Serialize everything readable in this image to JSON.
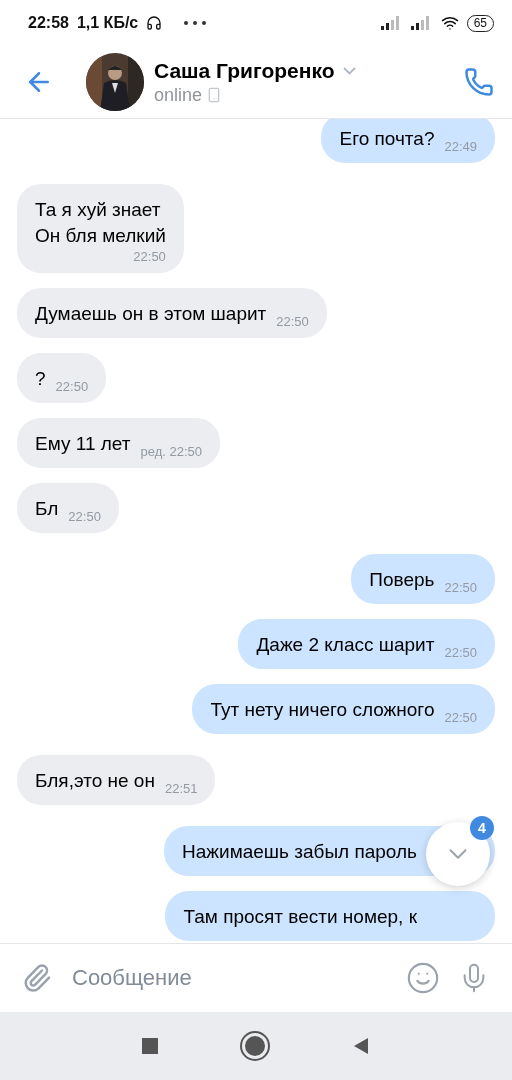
{
  "status_bar": {
    "time": "22:58",
    "speed": "1,1 КБ/с",
    "battery": "65"
  },
  "header": {
    "name": "Саша Григоренко",
    "status": "online"
  },
  "messages": [
    {
      "kind": "outgoing",
      "lines": [
        "Его почта?"
      ],
      "time": "22:49"
    },
    {
      "kind": "incoming",
      "lines": [
        "Та я хуй знает",
        "Он бля мелкий"
      ],
      "time": "22:50"
    },
    {
      "kind": "incoming",
      "lines": [
        "Думаешь он в этом шарит"
      ],
      "time": "22:50"
    },
    {
      "kind": "incoming",
      "lines": [
        "?"
      ],
      "time": "22:50"
    },
    {
      "kind": "incoming",
      "lines": [
        "Ему 11 лет"
      ],
      "time": "ред. 22:50"
    },
    {
      "kind": "incoming",
      "lines": [
        "Бл"
      ],
      "time": "22:50"
    },
    {
      "kind": "outgoing",
      "lines": [
        "Поверь"
      ],
      "time": "22:50"
    },
    {
      "kind": "outgoing",
      "lines": [
        "Даже 2 класс шарит"
      ],
      "time": "22:50"
    },
    {
      "kind": "outgoing",
      "lines": [
        "Тут нету ничего сложного"
      ],
      "time": "22:50"
    },
    {
      "kind": "incoming",
      "lines": [
        "Бля,это не он"
      ],
      "time": "22:51"
    },
    {
      "kind": "outgoing",
      "lines": [
        "Нажимаешь забыл пароль"
      ]
    },
    {
      "kind": "outgoing",
      "lines": [
        "Там просят вести номер, к"
      ]
    }
  ],
  "scroll_button": {
    "badge": "4"
  },
  "composer": {
    "placeholder": "Сообщение"
  }
}
